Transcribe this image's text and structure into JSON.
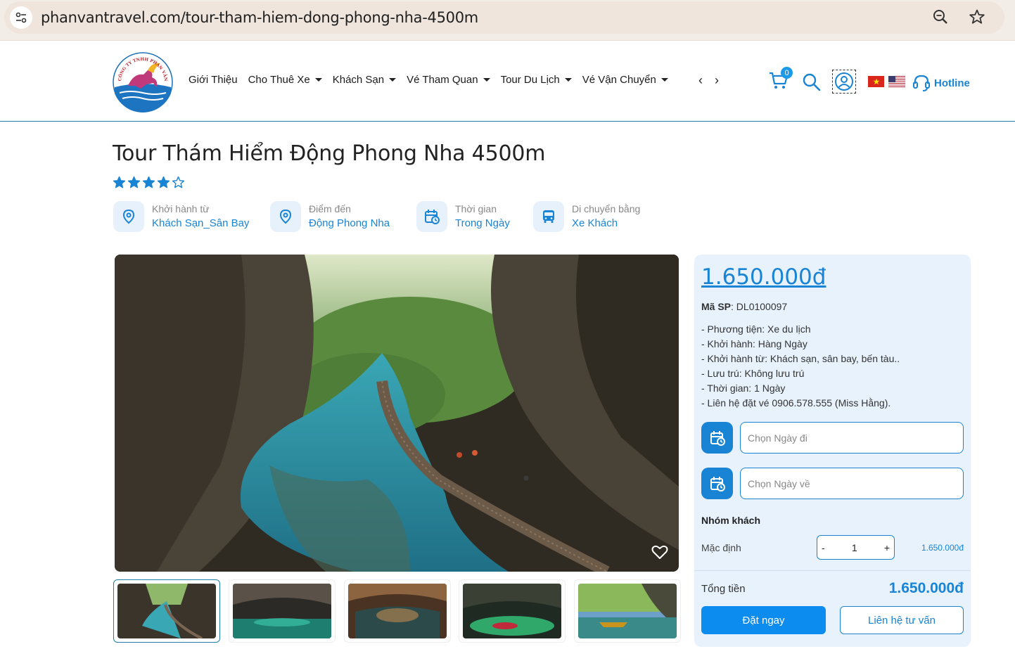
{
  "browser": {
    "url": "phanvantravel.com/tour-tham-hiem-dong-phong-nha-4500m",
    "icons": [
      "site-info-icon",
      "zoom-icon",
      "bookmark-star-icon"
    ]
  },
  "header": {
    "logo_text": "CÔNG TY TNHH PHAN VĂN",
    "nav": [
      {
        "label": "Giới Thiệu",
        "has_dropdown": false
      },
      {
        "label": "Cho Thuê Xe",
        "has_dropdown": true
      },
      {
        "label": "Khách Sạn",
        "has_dropdown": true
      },
      {
        "label": "Vé Tham Quan",
        "has_dropdown": true
      },
      {
        "label": "Tour Du Lịch",
        "has_dropdown": true
      },
      {
        "label": "Vé Vận Chuyển",
        "has_dropdown": true
      }
    ],
    "nav_arrows": "‹ ›",
    "cart_count": "0",
    "hotline": "Hotline"
  },
  "product": {
    "title": "Tour Thám Hiểm Động Phong Nha 4500m",
    "rating": 4,
    "rating_max": 5,
    "info": [
      {
        "label": "Khởi hành từ",
        "value": "Khách Sạn_Sân Bay",
        "icon": "location-pin-icon"
      },
      {
        "label": "Điểm đến",
        "value": "Động Phong Nha",
        "icon": "location-pin-icon"
      },
      {
        "label": "Thời gian",
        "value": "Trong Ngày",
        "icon": "calendar-clock-icon"
      },
      {
        "label": "Di chuyển bằng",
        "value": "Xe Khách",
        "icon": "bus-icon"
      }
    ],
    "thumbnail_count": 5
  },
  "booking": {
    "price": "1.650.000đ",
    "sku_label": "Mã SP",
    "sku_value": ": DL0100097",
    "details": [
      "- Phương tiện: Xe du lịch",
      "- Khởi hành: Hàng Ngày",
      "- Khởi hành từ: Khách sạn, sân bay, bến tàu..",
      "- Lưu trú: Không lưu trú",
      "- Thời gian: 1 Ngày",
      "- Liên hệ đặt vé 0906.578.555 (Miss Hằng)."
    ],
    "depart_placeholder": "Chọn Ngày đi",
    "return_placeholder": "Chọn Ngày về",
    "group_title": "Nhóm khách",
    "default_label": "Mặc định",
    "minus": "-",
    "quantity": "1",
    "plus": "+",
    "unit_price": "1.650.000đ",
    "total_label": "Tổng tiền",
    "total_value": "1.650.000đ",
    "book_label": "Đặt ngay",
    "contact_label": "Liên hệ tư vấn"
  },
  "colors": {
    "accent": "#1a84d4",
    "panel_bg": "#e7f2fc",
    "book_button": "#0d8cf0"
  }
}
